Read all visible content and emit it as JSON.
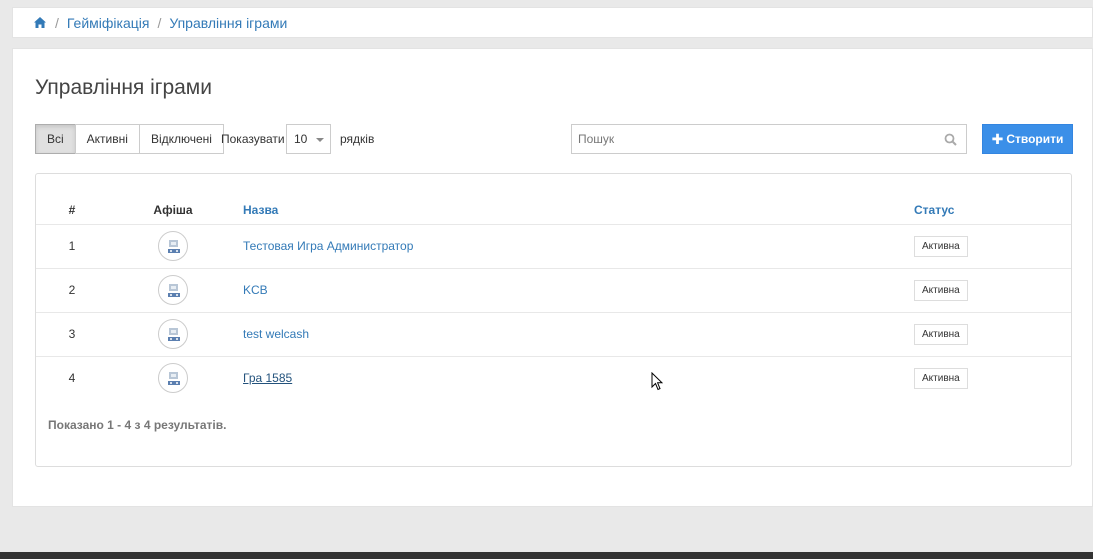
{
  "breadcrumb": {
    "home_icon": "home-icon",
    "items": [
      "Геймiфiкацiя",
      "Управлiння iграми"
    ],
    "separator": "/"
  },
  "page": {
    "title": "Управлiння iграми"
  },
  "filters": {
    "all": "Всi",
    "active": "Активнi",
    "disabled": "Вiдключенi",
    "selected": "Всi"
  },
  "rows_per_page": {
    "show_label": "Показувати",
    "value": "10",
    "rows_label": "рядкiв"
  },
  "search": {
    "placeholder": "Пошук",
    "value": ""
  },
  "create_button": {
    "label": "Створити",
    "icon": "plus-icon",
    "color": "#3b8fe8"
  },
  "table": {
    "columns": {
      "num": "#",
      "image": "Афiша",
      "name": "Назва",
      "status": "Статус"
    },
    "rows": [
      {
        "num": "1",
        "name": "Тестовая Игра Администратор",
        "status": "Активна"
      },
      {
        "num": "2",
        "name": "KCB",
        "status": "Активна"
      },
      {
        "num": "3",
        "name": "test welcash",
        "status": "Активна"
      },
      {
        "num": "4",
        "name": "Гра 1585",
        "status": "Активна"
      }
    ],
    "summary": "Показано 1 - 4 з 4 результатiв."
  },
  "colors": {
    "link": "#337ab7",
    "accent": "#3b8fe8"
  }
}
